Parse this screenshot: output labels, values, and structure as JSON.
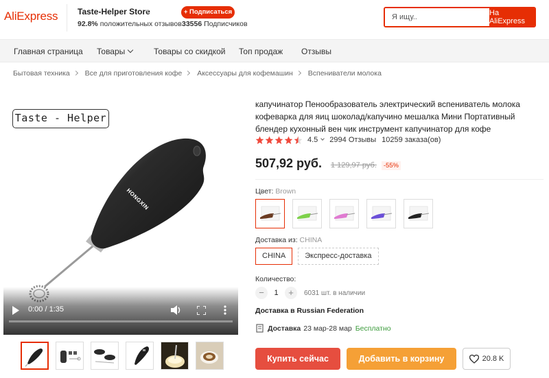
{
  "header": {
    "logo": "AliExpress",
    "store_name": "Taste-Helper Store",
    "positive_pct": "92.8%",
    "positive_label": "положительных отзывов",
    "subscribe_label": "+ Подписаться",
    "subscribers_count": "33556",
    "subscribers_label": "Подписчиков",
    "search_placeholder": "Я ищу..",
    "search_button": "На AliExpress"
  },
  "nav": {
    "items": [
      "Главная страница",
      "Товары",
      "Товары со скидкой",
      "Топ продаж",
      "Отзывы"
    ]
  },
  "breadcrumb": [
    "Бытовая техника",
    "Все для приготовления кофе",
    "Аксессуары для кофемашин",
    "Вспениватели молока"
  ],
  "media": {
    "watermark": "Taste - Helper",
    "brand_text": "HONGXIN",
    "video_time": "0:00 / 1:35",
    "thumbnails": [
      "frother-black",
      "parts-set",
      "frother-pair",
      "frother-closeup",
      "frothing-milk",
      "coffee-cup"
    ]
  },
  "product": {
    "title": "капучинатор Пенообразователь электрический вспениватель молока кофеварка для яиц шоколад/капучино мешалка Мини Портативный блендер кухонный вен чик инструмент капучинатор для кофе",
    "rating": "4.5",
    "reviews": "2994 Отзывы",
    "orders": "10259 заказа(ов)",
    "price": "507,92 руб.",
    "old_price": "1 129,97 руб.",
    "discount": "-55%",
    "color_label": "Цвет:",
    "color_value": "Brown",
    "color_options": [
      {
        "name": "brown",
        "accent": "#6b3b22"
      },
      {
        "name": "green",
        "accent": "#7dd14a"
      },
      {
        "name": "pink",
        "accent": "#e07ad1"
      },
      {
        "name": "purple",
        "accent": "#6b4fd8"
      },
      {
        "name": "black",
        "accent": "#222222"
      }
    ],
    "ship_from_label": "Доставка из:",
    "ship_from_value": "CHINA",
    "ship_options": [
      "CHINA",
      "Экспресс-доставка"
    ],
    "qty_label": "Количество:",
    "qty_minus": "−",
    "qty_value": "1",
    "qty_plus": "+",
    "stock": "6031 шт. в наличии",
    "deliver_to": "Доставка в Russian Federation",
    "delivery_label": "Доставка",
    "delivery_dates": "23 мар-28 мар",
    "delivery_price": "Бесплатно",
    "buy_now": "Купить сейчас",
    "add_to_cart": "Добавить в корзину",
    "wishlist_count": "20.8 K"
  },
  "colors": {
    "brand": "#e62e04",
    "buy": "#e64e3f",
    "cart": "#f5a036",
    "star": "#f04a3d",
    "free": "#3a9a3a"
  }
}
